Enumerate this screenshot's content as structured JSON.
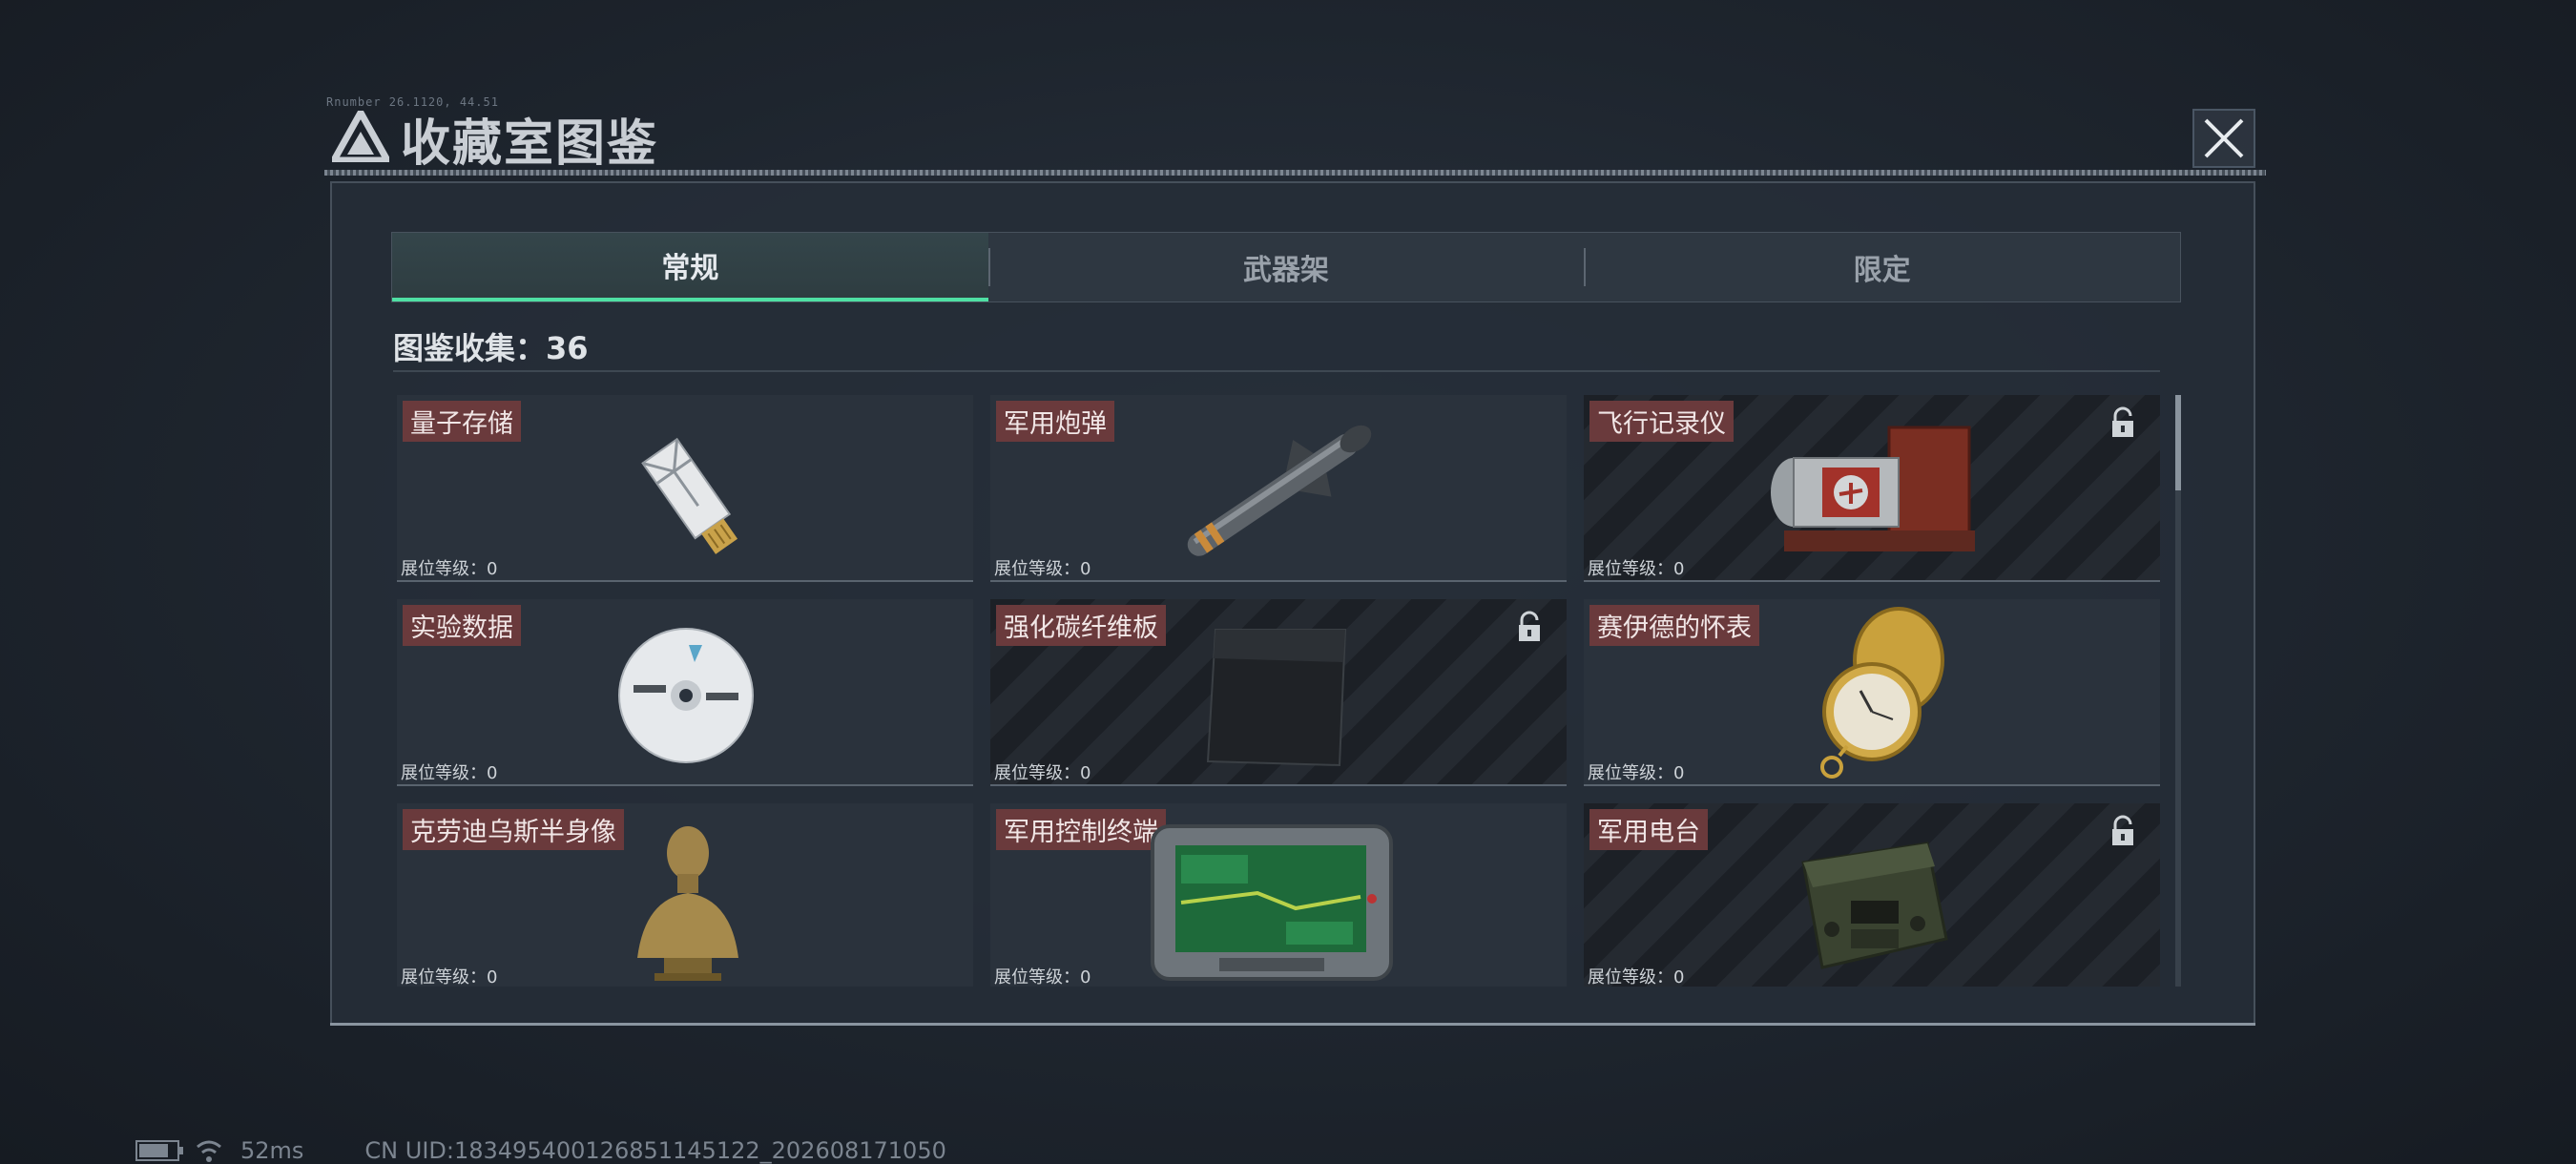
{
  "header": {
    "code": "Rnumber 26.1120, 44.51",
    "title": "收藏室图鉴",
    "close_icon": "close-icon"
  },
  "tabs": [
    {
      "label": "常规",
      "active": true
    },
    {
      "label": "武器架",
      "active": false
    },
    {
      "label": "限定",
      "active": false
    }
  ],
  "collection": {
    "label": "图鉴收集：36"
  },
  "cards": [
    {
      "name": "量子存储",
      "footer": "展位等级：0",
      "locked": false,
      "icon": "usb-drive-icon"
    },
    {
      "name": "军用炮弹",
      "footer": "展位等级：0",
      "locked": false,
      "icon": "missile-icon"
    },
    {
      "name": "飞行记录仪",
      "footer": "展位等级：0",
      "locked": true,
      "icon": "flight-recorder-icon"
    },
    {
      "name": "实验数据",
      "footer": "展位等级：0",
      "locked": false,
      "icon": "disc-icon"
    },
    {
      "name": "强化碳纤维板",
      "footer": "展位等级：0",
      "locked": true,
      "icon": "carbon-plate-icon"
    },
    {
      "name": "赛伊德的怀表",
      "footer": "展位等级：0",
      "locked": false,
      "icon": "pocket-watch-icon"
    },
    {
      "name": "克劳迪乌斯半身像",
      "footer": "展位等级：0",
      "locked": false,
      "icon": "bust-icon"
    },
    {
      "name": "军用控制终端",
      "footer": "展位等级：0",
      "locked": false,
      "icon": "control-terminal-icon"
    },
    {
      "name": "军用电台",
      "footer": "展位等级：0",
      "locked": true,
      "icon": "military-radio-icon"
    }
  ],
  "status": {
    "battery_level": 0.8,
    "ping": "52ms",
    "uid": "CN UID:183495400126851145122_202608171050"
  },
  "colors": {
    "accent": "#4fe0a4",
    "label_bg": "#6a3a3c"
  }
}
